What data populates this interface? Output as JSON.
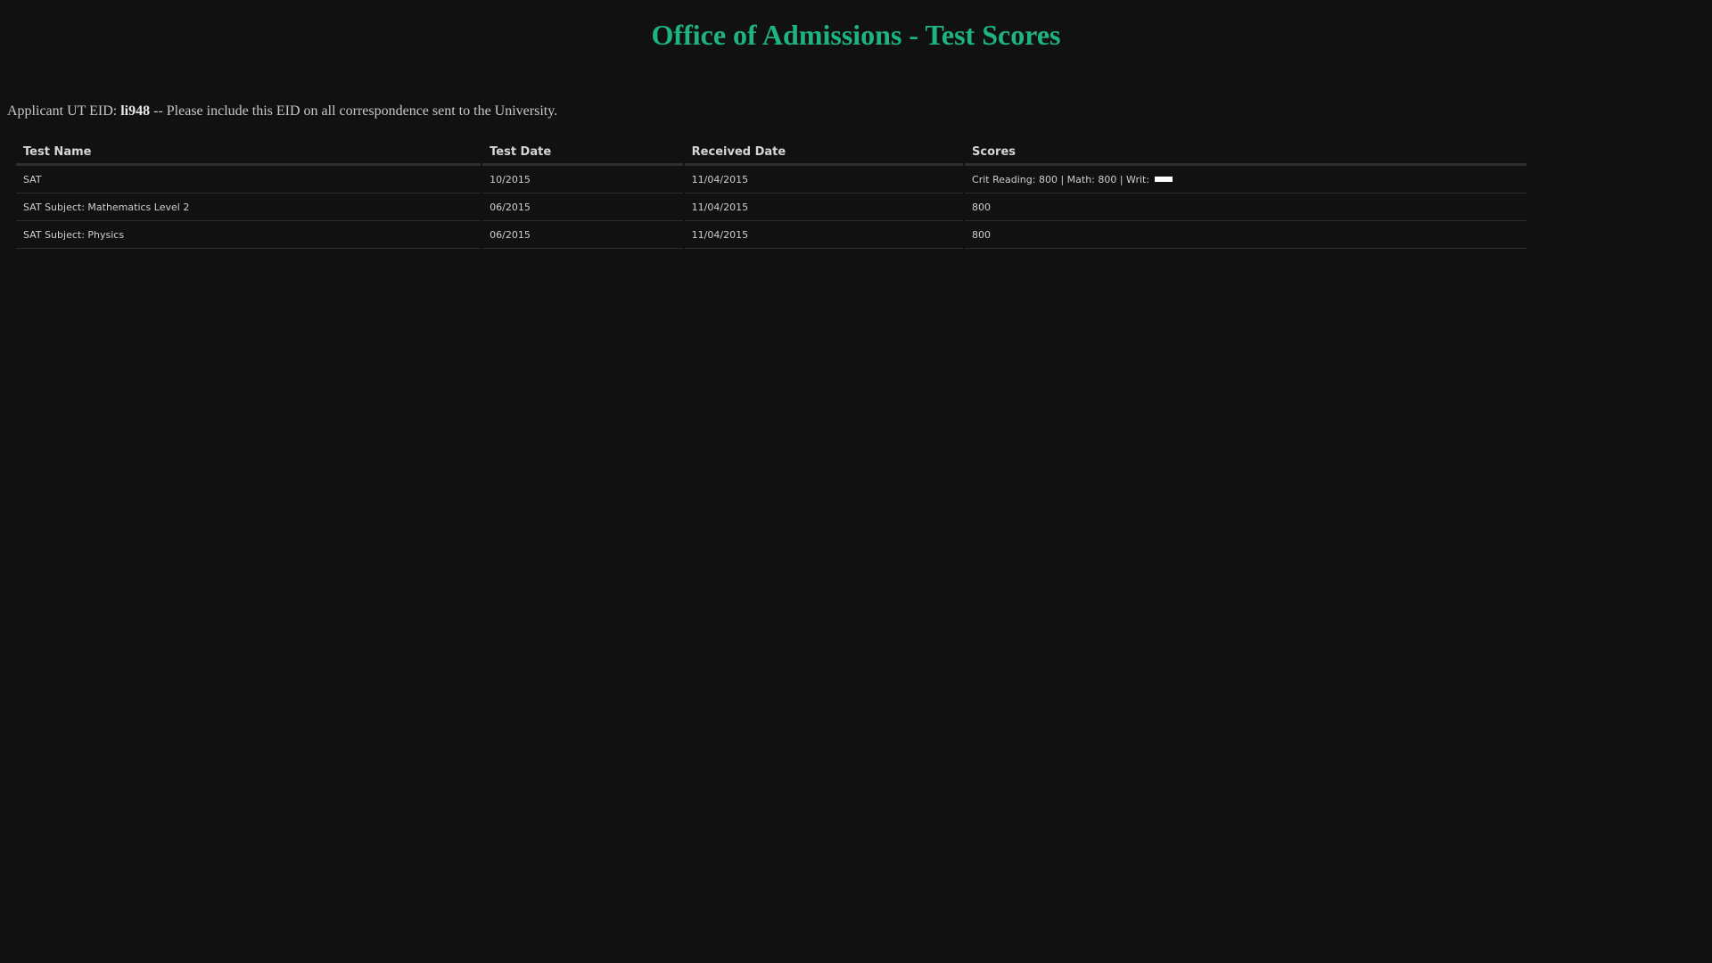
{
  "page": {
    "title": "Office of Admissions - Test Scores",
    "eid_prefix": "Applicant UT EID: ",
    "eid": "li948",
    "eid_suffix": " -- Please include this EID on all correspondence sent to the University."
  },
  "table": {
    "headers": [
      "Test Name",
      "Test Date",
      "Received Date",
      "Scores"
    ],
    "rows": [
      {
        "test_name": "SAT",
        "test_date": "10/2015",
        "received_date": "11/04/2015",
        "scores": "Crit Reading: 800 | Math: 800 | Writ:",
        "redacted": true
      },
      {
        "test_name": "SAT Subject: Mathematics Level 2",
        "test_date": "06/2015",
        "received_date": "11/04/2015",
        "scores": "800",
        "redacted": false
      },
      {
        "test_name": "SAT Subject: Physics",
        "test_date": "06/2015",
        "received_date": "11/04/2015",
        "scores": "800",
        "redacted": false
      }
    ]
  },
  "colors": {
    "background": "#111111",
    "title": "#1db383",
    "text": "#cfcfcf",
    "redaction": "#ffffff"
  }
}
